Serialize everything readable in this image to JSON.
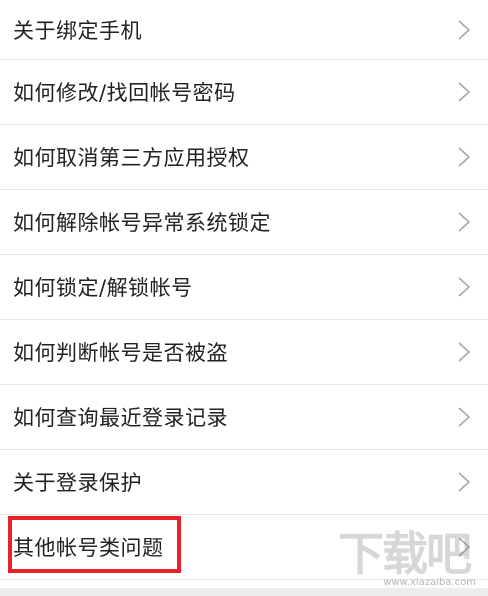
{
  "menu": {
    "items": [
      {
        "label": "关于绑定手机"
      },
      {
        "label": "如何修改/找回帐号密码"
      },
      {
        "label": "如何取消第三方应用授权"
      },
      {
        "label": "如何解除帐号异常系统锁定"
      },
      {
        "label": "如何锁定/解锁帐号"
      },
      {
        "label": "如何判断帐号是否被盗"
      },
      {
        "label": "如何查询最近登录记录"
      },
      {
        "label": "关于登录保护"
      },
      {
        "label": "其他帐号类问题"
      }
    ]
  },
  "annotation": {
    "highlight_color": "#e8222d"
  },
  "watermark": {
    "text": "下载吧",
    "url": "www.xiazaiba.com"
  },
  "colors": {
    "text": "#222222",
    "chevron": "#a8a8a8",
    "divider": "#e6e6e6"
  },
  "icons": {
    "chevron": "chevron-right-icon"
  }
}
